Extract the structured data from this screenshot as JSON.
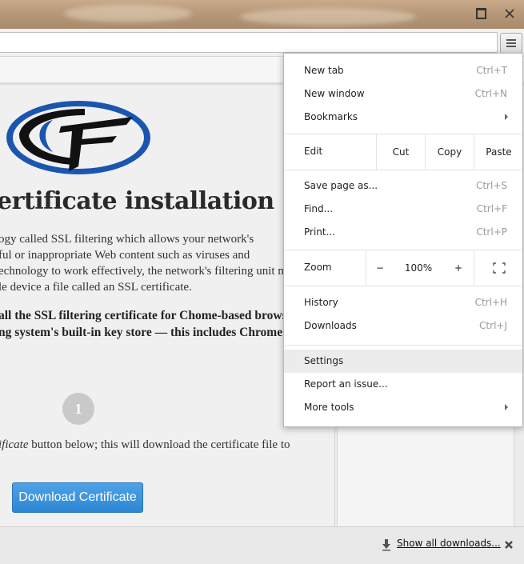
{
  "window": {
    "icons": {
      "maximize": "maximize-icon",
      "close": "close-icon"
    }
  },
  "toolbar": {
    "menu_icon": "hamburger-menu-icon"
  },
  "page": {
    "title": "ertificate installation",
    "paragraph1": [
      "ogy called SSL filtering which allows your network's",
      "ful or inappropriate Web content such as viruses and",
      "echnology to work effectively, the network's filtering unit mu",
      "le device a file called an SSL certificate."
    ],
    "paragraph2": [
      "all the SSL filtering certificate for Chome-based brows",
      "ng system's built-in key store — this includes Chrome"
    ],
    "step_number": "1",
    "step_text_em": "ificate",
    "step_text_rest": " button below; this will download the certificate file to",
    "download_button": "Download Certificate",
    "brand_colors": {
      "blue": "#1a55b0",
      "black": "#111111"
    }
  },
  "menu": {
    "new_tab": {
      "label": "New tab",
      "shortcut": "Ctrl+T"
    },
    "new_window": {
      "label": "New window",
      "shortcut": "Ctrl+N"
    },
    "bookmarks": {
      "label": "Bookmarks"
    },
    "edit": {
      "label": "Edit",
      "cut": "Cut",
      "copy": "Copy",
      "paste": "Paste"
    },
    "save_page": {
      "label": "Save page as...",
      "shortcut": "Ctrl+S"
    },
    "find": {
      "label": "Find...",
      "shortcut": "Ctrl+F"
    },
    "print": {
      "label": "Print...",
      "shortcut": "Ctrl+P"
    },
    "zoom": {
      "label": "Zoom",
      "minus": "−",
      "value": "100%",
      "plus": "+"
    },
    "history": {
      "label": "History",
      "shortcut": "Ctrl+H"
    },
    "downloads": {
      "label": "Downloads",
      "shortcut": "Ctrl+J"
    },
    "settings": {
      "label": "Settings"
    },
    "report_issue": {
      "label": "Report an issue..."
    },
    "more_tools": {
      "label": "More tools"
    }
  },
  "shelf": {
    "show_all": "Show all downloads...",
    "icons": {
      "download": "download-arrow-icon",
      "close": "close-icon"
    }
  }
}
